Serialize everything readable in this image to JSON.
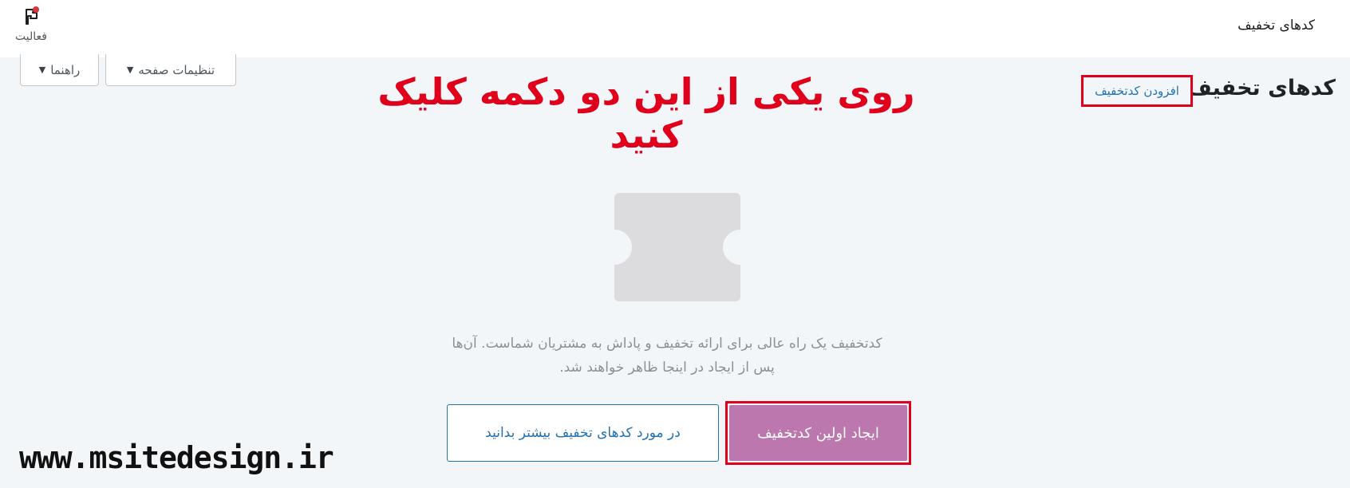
{
  "topbar": {
    "title": "کدهای تخفیف",
    "activity_label": "فعالیت",
    "activity_icon": "flag-icon"
  },
  "header": {
    "help_label": "راهنما",
    "screen_options_label": "تنظیمات صفحه",
    "page_title": "کدهای تخفیف",
    "add_coupon_label": "افزودن کدتخفیف"
  },
  "annotation": {
    "text": "روی یکی از این دو دکمه کلیک کنید",
    "color": "#e0001b"
  },
  "empty_state": {
    "icon": "coupon-icon",
    "line1": "کدتخفیف یک راه عالی برای ارائه تخفیف و پاداش به مشتریان شماست. آن‌ها",
    "line2": "پس از ایجاد در اینجا ظاهر خواهند شد.",
    "learn_more_label": "در مورد کدهای تخفیف بیشتر بدانید",
    "create_label": "ایجاد اولین کدتخفیف"
  },
  "colors": {
    "primary_button": "#bb77ae",
    "link": "#2271b1",
    "background": "#f3f6f9"
  },
  "watermark": "www.msitedesign.ir"
}
